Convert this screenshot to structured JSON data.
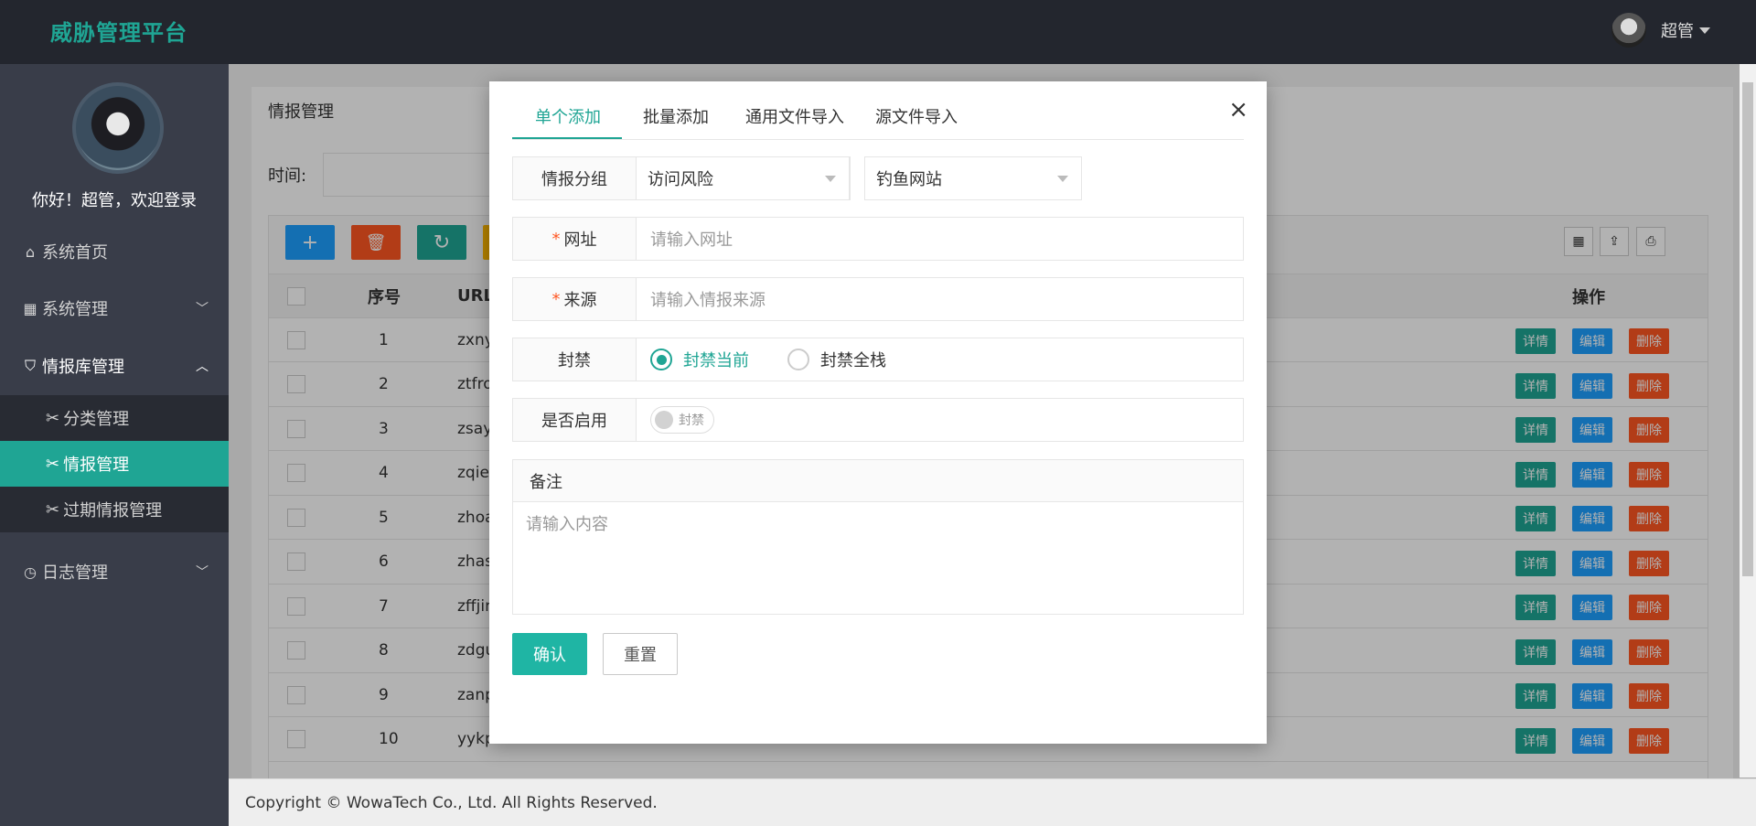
{
  "app": {
    "title": "威胁管理平台",
    "user_name": "超管"
  },
  "sidebar": {
    "welcome": "你好！超管，欢迎登录",
    "items": [
      {
        "label": "系统首页",
        "icon": "home-icon"
      },
      {
        "label": "系统管理",
        "icon": "apps-icon"
      },
      {
        "label": "情报库管理",
        "icon": "shield-icon"
      },
      {
        "label": "日志管理",
        "icon": "clock-icon"
      }
    ],
    "subitems": [
      {
        "label": "分类管理",
        "icon": "wrench-icon"
      },
      {
        "label": "情报管理",
        "icon": "wrench-icon",
        "active": true
      },
      {
        "label": "过期情报管理",
        "icon": "wrench-icon"
      }
    ]
  },
  "panel": {
    "title": "情报管理",
    "search_label": "时间:"
  },
  "toolbar": {
    "add_icon": "+",
    "delete_icon": "🗑",
    "refresh_icon": "↻"
  },
  "table": {
    "headers": {
      "seq": "序号",
      "url": "URL",
      "ops": "操作"
    },
    "rows": [
      {
        "seq": "1",
        "url": "zxny"
      },
      {
        "seq": "2",
        "url": "ztfro"
      },
      {
        "seq": "3",
        "url": "zsay"
      },
      {
        "seq": "4",
        "url": "zqie"
      },
      {
        "seq": "5",
        "url": "zhoa"
      },
      {
        "seq": "6",
        "url": "zhas"
      },
      {
        "seq": "7",
        "url": "zffjin"
      },
      {
        "seq": "8",
        "url": "zdgu"
      },
      {
        "seq": "9",
        "url": "zanp"
      },
      {
        "seq": "10",
        "url": "yykp"
      }
    ],
    "actions": {
      "detail": "详情",
      "edit": "编辑",
      "delete": "删除"
    }
  },
  "footer": {
    "copyright": "Copyright ©  WowaTech Co., Ltd. All Rights Reserved."
  },
  "modal": {
    "tabs": [
      "单个添加",
      "批量添加",
      "通用文件导入",
      "源文件导入"
    ],
    "close": "×",
    "group_label": "情报分组",
    "group_value": "访问风险",
    "subgroup_value": "钓鱼网站",
    "url_label": "网址",
    "url_placeholder": "请输入网址",
    "source_label": "来源",
    "source_placeholder": "请输入情报来源",
    "ban_label": "封禁",
    "ban_options": [
      "封禁当前",
      "封禁全栈"
    ],
    "enable_label": "是否启用",
    "enable_switch_text": "封禁",
    "remark_label": "备注",
    "remark_placeholder": "请输入内容",
    "confirm": "确认",
    "reset": "重置"
  },
  "colors": {
    "primary": "#1fa594",
    "add": "#1e9fff",
    "delete": "#ff5722",
    "refresh": "#1fa594",
    "detail": "#1fa594",
    "edit": "#1e9fff",
    "danger": "#ff5722"
  }
}
